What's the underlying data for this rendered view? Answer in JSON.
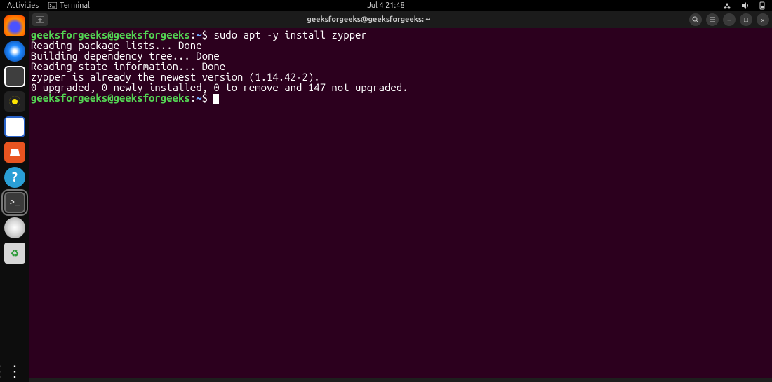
{
  "topbar": {
    "activities": "Activities",
    "app_icon": "terminal-icon",
    "app_label": "Terminal",
    "clock": "Jul 4  21:48",
    "status": {
      "network": "network-icon",
      "volume": "volume-icon",
      "power": "power-icon"
    }
  },
  "dock": {
    "items": [
      {
        "name": "firefox-icon"
      },
      {
        "name": "thunderbird-icon"
      },
      {
        "name": "files-icon"
      },
      {
        "name": "rhythmbox-icon"
      },
      {
        "name": "libreoffice-writer-icon"
      },
      {
        "name": "software-center-icon"
      },
      {
        "name": "help-icon",
        "glyph": "?"
      },
      {
        "name": "terminal-icon",
        "glyph": ">_",
        "active": true
      },
      {
        "name": "disk-icon"
      },
      {
        "name": "trash-icon"
      }
    ],
    "apps_button": {
      "name": "show-apps-icon",
      "glyph": "⋮⋮⋮"
    }
  },
  "window": {
    "title": "geeksforgeeks@geeksforgeeks: ~",
    "tabs_plus": "+",
    "buttons": {
      "search": "search-icon",
      "menu": "menu-icon",
      "min": "–",
      "max": "□",
      "close": "×"
    }
  },
  "terminal": {
    "prompt_user": "geeksforgeeks@geeksforgeeks",
    "prompt_sep": ":",
    "prompt_path": "~",
    "prompt_symbol": "$",
    "command1": "sudo apt -y install zypper",
    "output": [
      "Reading package lists... Done",
      "Building dependency tree... Done",
      "Reading state information... Done",
      "zypper is already the newest version (1.14.42-2).",
      "0 upgraded, 0 newly installed, 0 to remove and 147 not upgraded."
    ]
  }
}
